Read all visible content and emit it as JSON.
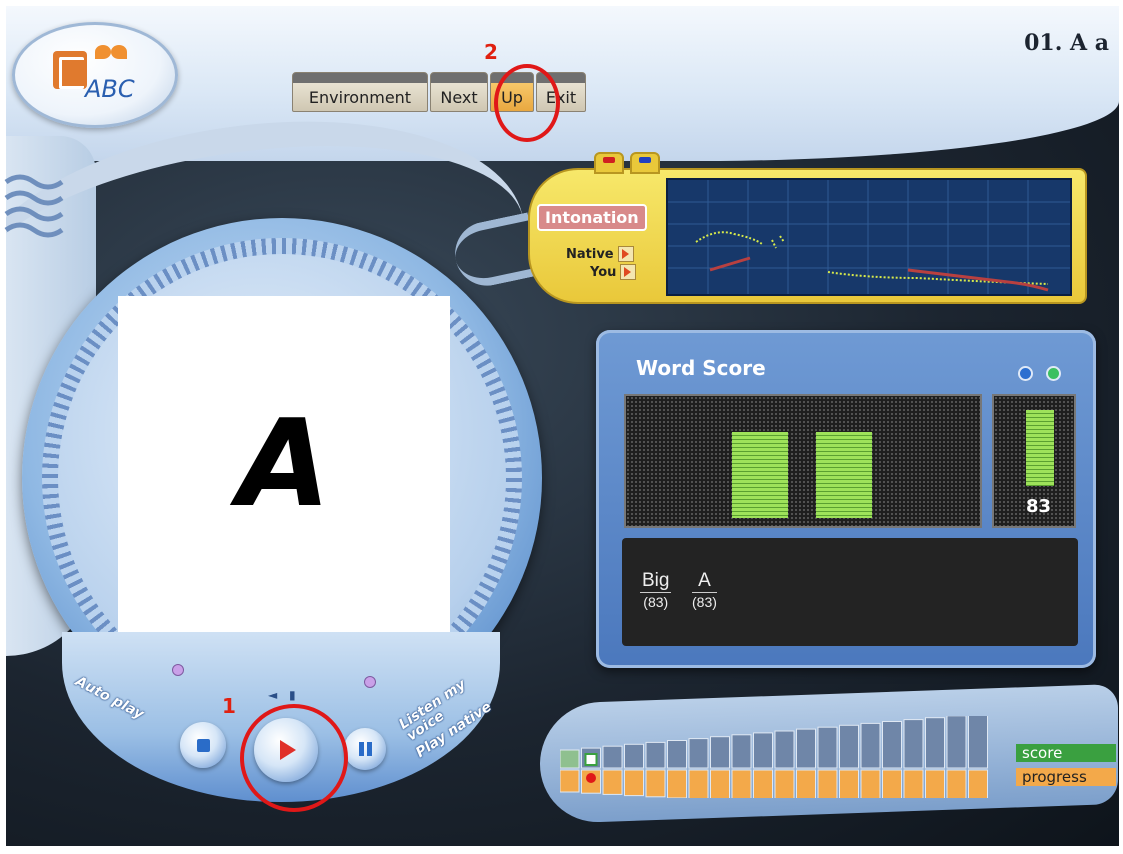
{
  "title": "01. A a",
  "logo": {
    "text": "ABC"
  },
  "nav": [
    {
      "label": "Environment",
      "active": false
    },
    {
      "label": "Next",
      "active": false
    },
    {
      "label": "Up",
      "active": true
    },
    {
      "label": "Exit",
      "active": false
    }
  ],
  "markers": {
    "one": "1",
    "two": "2"
  },
  "player": {
    "display_letter": "A",
    "auto_play_label": "Auto play",
    "listen_label": "Listen my voice",
    "play_native_label": "Play native"
  },
  "intonation": {
    "label": "Intonation",
    "native_label": "Native",
    "you_label": "You"
  },
  "word_score": {
    "title": "Word Score",
    "bars": [
      0.85,
      0.85
    ],
    "overall_fraction": 0.83,
    "overall_score": "83",
    "words": [
      {
        "word": "Big",
        "score": "(83)"
      },
      {
        "word": "A",
        "score": "(83)"
      }
    ]
  },
  "score_progress": {
    "score_label": "score",
    "progress_label": "progress",
    "current_index": 1,
    "columns": 20
  },
  "colors": {
    "accent_red": "#e01818",
    "score_green": "#3aa040",
    "progress_orange": "#f3a94a",
    "panel_blue": "#4b78bd"
  }
}
